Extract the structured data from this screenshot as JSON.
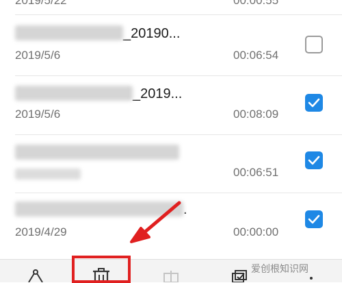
{
  "top_partial": {
    "date": "2019/5/22",
    "duration": "00:00:55"
  },
  "recordings": [
    {
      "title_suffix": "_20190...",
      "date": "2019/5/6",
      "duration": "00:06:54",
      "checked": false
    },
    {
      "title_suffix": "_2019...",
      "date": "2019/5/6",
      "duration": "00:08:09",
      "checked": true
    },
    {
      "title_suffix": "",
      "date": "2019/4/27",
      "duration": "00:06:51",
      "checked": true
    },
    {
      "title_suffix": ".",
      "date": "2019/4/29",
      "duration": "00:00:00",
      "checked": true
    }
  ],
  "toolbar": {
    "items": [
      "share-icon",
      "trash-icon",
      "rename-icon",
      "select-all-icon"
    ],
    "highlight_color": "#e02020"
  },
  "accent_color": "#1e88e5",
  "watermark": "爱创根知识网"
}
